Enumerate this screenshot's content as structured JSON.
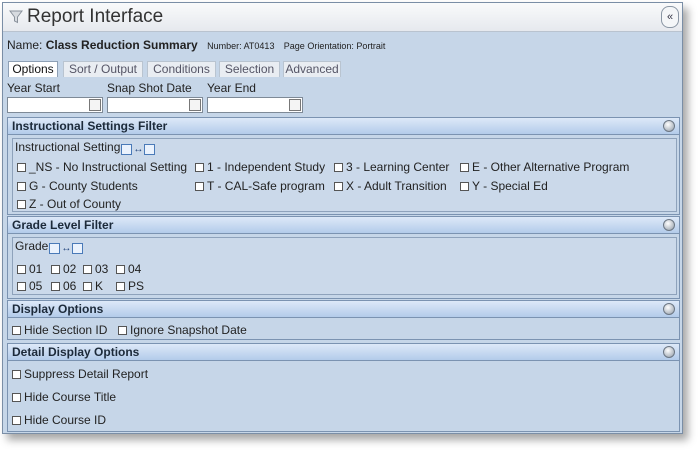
{
  "window": {
    "title": "Report Interface",
    "collapse_glyph": "«"
  },
  "report": {
    "name_label": "Name:",
    "name_value": "Class Reduction Summary",
    "number": "Number: AT0413",
    "orientation": "Page Orientation: Portrait"
  },
  "tabs": [
    "Options",
    "Sort / Output",
    "Conditions",
    "Selection",
    "Advanced"
  ],
  "fields": [
    {
      "label": "Year Start",
      "value": ""
    },
    {
      "label": "Snap Shot Date",
      "value": ""
    },
    {
      "label": "Year End",
      "value": ""
    }
  ],
  "instructional": {
    "header": "Instructional Settings Filter",
    "group_label": "Instructional Setting",
    "options": [
      "_NS - No Instructional Setting",
      "1 - Independent Study",
      "3 - Learning Center",
      "E - Other Alternative Program",
      "G - County Students",
      "T - CAL-Safe program",
      "X - Adult Transition",
      "Y - Special Ed",
      "Z - Out of County"
    ]
  },
  "grade": {
    "header": "Grade Level Filter",
    "group_label": "Grade",
    "options": [
      "01",
      "02",
      "03",
      "04",
      "05",
      "06",
      "K",
      "PS"
    ]
  },
  "display": {
    "header": "Display Options",
    "options": [
      "Hide Section ID",
      "Ignore Snapshot Date"
    ]
  },
  "detail": {
    "header": "Detail Display Options",
    "options": [
      "Suppress Detail Report",
      "Hide Course Title",
      "Hide Course ID"
    ]
  },
  "icons": {
    "title": "filter-funnel-icon",
    "date": "calendar-icon",
    "toggle": "collapse-circle-icon",
    "select_all": "select-all-toggle-icon"
  }
}
